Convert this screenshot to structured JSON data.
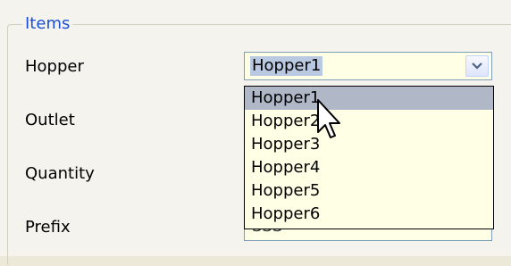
{
  "group": {
    "title": "Items"
  },
  "fields": {
    "hopper": {
      "label": "Hopper",
      "value": "Hopper1"
    },
    "outlet": {
      "label": "Outlet"
    },
    "quantity": {
      "label": "Quantity"
    },
    "prefix": {
      "label": "Prefix",
      "value": "SSS"
    }
  },
  "dropdown": {
    "options": [
      "Hopper1",
      "Hopper2",
      "Hopper3",
      "Hopper4",
      "Hopper5",
      "Hopper6"
    ],
    "highlighted": "Hopper1"
  },
  "icons": {
    "combo_button": "chevron-down-icon",
    "pointer": "mouse-cursor-icon"
  },
  "colors": {
    "title": "#1a4fd6",
    "field_bg": "#ffffe6",
    "highlight": "#b0b8c8",
    "selected_value_bg": "#b9c9e1"
  }
}
